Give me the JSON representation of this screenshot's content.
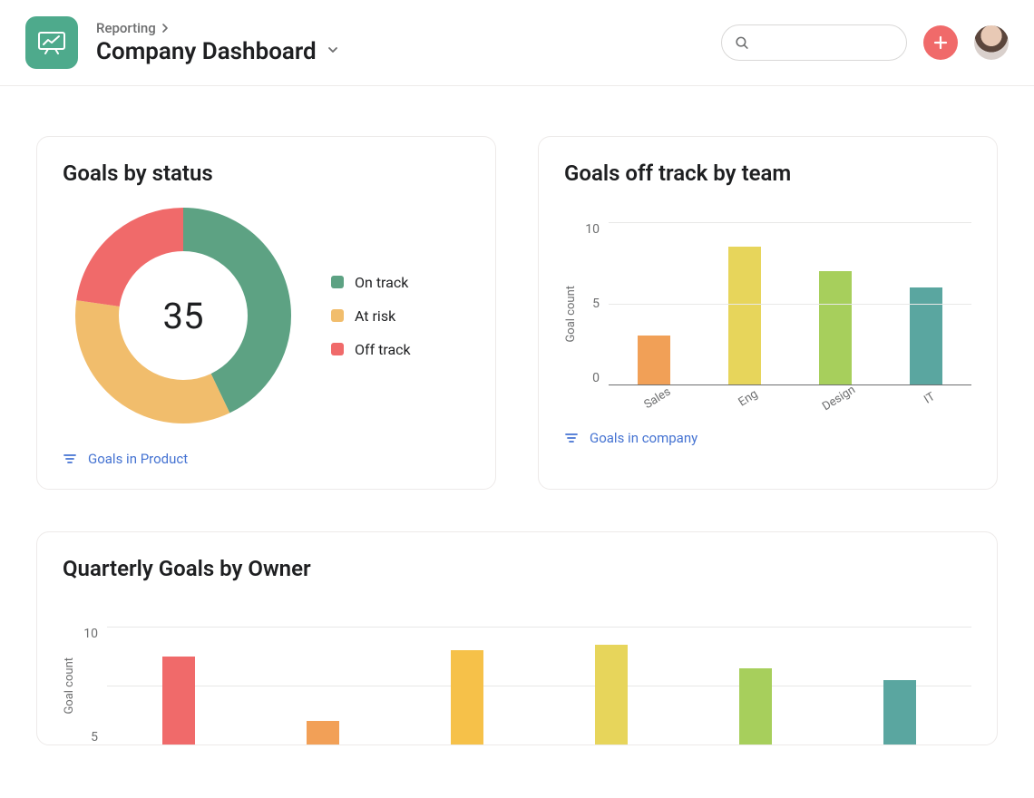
{
  "header": {
    "breadcrumb": "Reporting",
    "title": "Company Dashboard",
    "search_placeholder": ""
  },
  "colors": {
    "on_track": "#5da283",
    "at_risk": "#f1bd6c",
    "off_track": "#f06a6a"
  },
  "chart_data": [
    {
      "id": "goals_by_status",
      "type": "pie",
      "title": "Goals by status",
      "center_value": "35",
      "series": [
        {
          "name": "On track",
          "value": 15,
          "color": "#5da283"
        },
        {
          "name": "At risk",
          "value": 12,
          "color": "#f1bd6c"
        },
        {
          "name": "Off track",
          "value": 8,
          "color": "#f06a6a"
        }
      ],
      "filter_label": "Goals in Product"
    },
    {
      "id": "goals_off_track_by_team",
      "type": "bar",
      "title": "Goals off track by team",
      "ylabel": "Goal count",
      "ylim": [
        0,
        10
      ],
      "y_ticks": [
        "10",
        "5",
        "0"
      ],
      "categories": [
        "Sales",
        "Eng",
        "Design",
        "IT"
      ],
      "values": [
        3,
        8.5,
        7,
        6
      ],
      "bar_colors": [
        "#f1a057",
        "#e7d55b",
        "#a7cf5c",
        "#5aa6a0"
      ],
      "filter_label": "Goals in company"
    },
    {
      "id": "quarterly_goals_by_owner",
      "type": "bar",
      "title": "Quarterly Goals by Owner",
      "ylabel": "Goal count",
      "ylim": [
        0,
        10
      ],
      "y_ticks": [
        "10",
        "5"
      ],
      "categories": [
        "",
        "",
        "",
        "",
        "",
        ""
      ],
      "values": [
        7.5,
        2,
        8,
        8.5,
        6.5,
        5.5
      ],
      "bar_colors": [
        "#f06a6a",
        "#f2a057",
        "#f6c149",
        "#e7d55b",
        "#a7cf5c",
        "#5aa6a0"
      ]
    }
  ]
}
